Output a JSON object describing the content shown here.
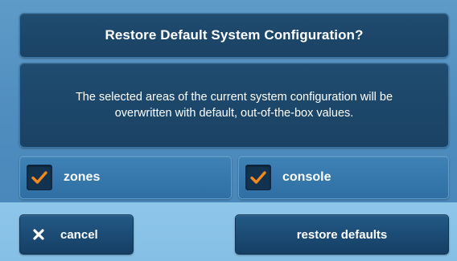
{
  "dialog": {
    "title": "Restore Default System Configuration?",
    "message": "The selected areas of the current system configuration will be\noverwritten with default, out-of-the-box values."
  },
  "options": [
    {
      "label": "zones",
      "checked": true,
      "icon": "check-icon"
    },
    {
      "label": "console",
      "checked": true,
      "icon": "check-icon"
    }
  ],
  "buttons": {
    "cancel_label": "cancel",
    "cancel_icon": "close-icon",
    "restore_label": "restore defaults"
  },
  "colors": {
    "check_accent": "#f08a1c",
    "panel_dark": "#1a4264",
    "background": "#4f8dbf"
  }
}
